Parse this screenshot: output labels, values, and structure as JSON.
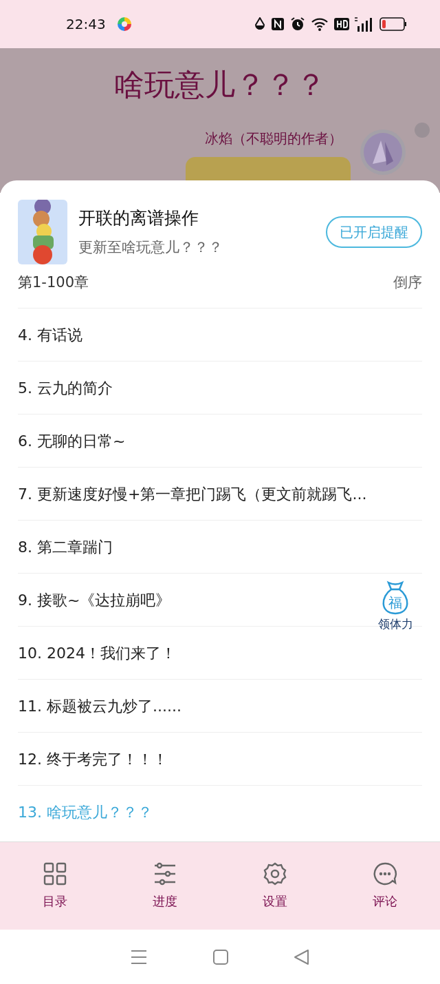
{
  "status_bar": {
    "time": "22:43"
  },
  "background": {
    "title": "啥玩意儿？？？",
    "speaker": "冰焰（不聪明的作者）"
  },
  "sheet": {
    "book_title": "开联的离谱操作",
    "update_text": "更新至啥玩意儿？？？",
    "reminder_button": "已开启提醒",
    "range": "第1-100章",
    "sort_button": "倒序",
    "chapters": [
      {
        "title": "4. 有话说",
        "selected": false
      },
      {
        "title": "5. 云九的简介",
        "selected": false
      },
      {
        "title": "6. 无聊的日常~",
        "selected": false
      },
      {
        "title": "7. 更新速度好慢+第一章把门踢飞（更文前就踢飞...",
        "selected": false
      },
      {
        "title": "8. 第二章踹门",
        "selected": false
      },
      {
        "title": "9. 接歌~《达拉崩吧》",
        "selected": false
      },
      {
        "title": "10. 2024！我们来了！",
        "selected": false
      },
      {
        "title": "11. 标题被云九炒了......",
        "selected": false
      },
      {
        "title": "12. 终于考完了！！！",
        "selected": false
      },
      {
        "title": "13. 啥玩意儿？？？",
        "selected": true
      }
    ]
  },
  "reward": {
    "glyph": "福",
    "label": "领体力"
  },
  "bottom_nav": [
    {
      "kind": "grid",
      "label": "目录"
    },
    {
      "kind": "sliders",
      "label": "进度"
    },
    {
      "kind": "gear",
      "label": "设置"
    },
    {
      "kind": "chat",
      "label": "评论"
    }
  ]
}
